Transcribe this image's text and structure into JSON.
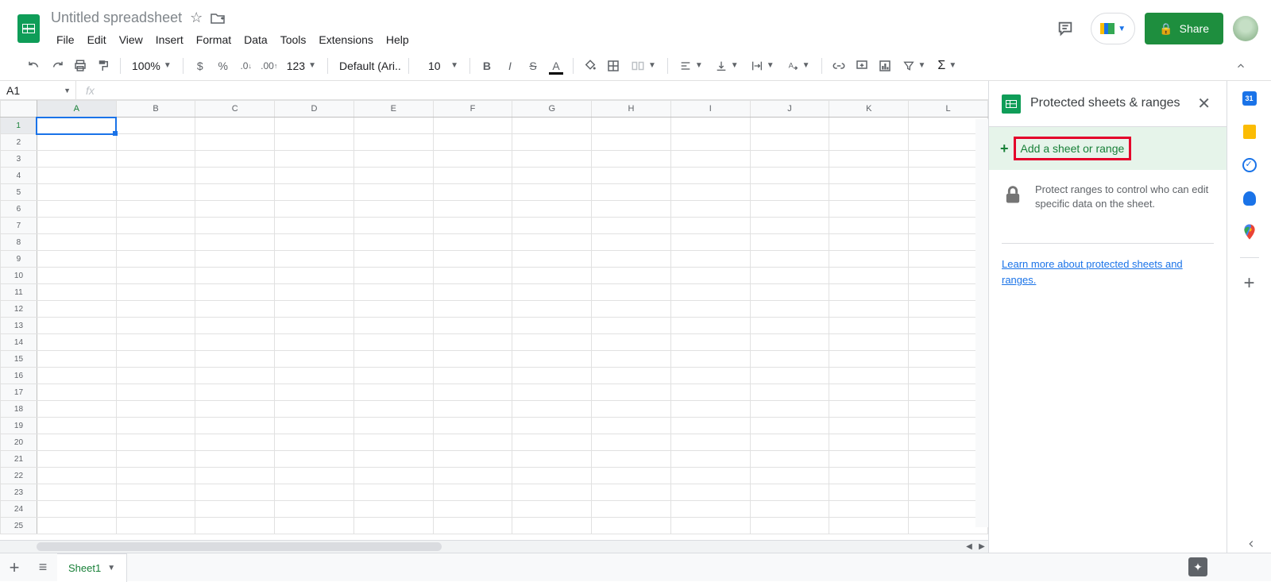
{
  "header": {
    "doc_title": "Untitled spreadsheet",
    "menus": [
      "File",
      "Edit",
      "View",
      "Insert",
      "Format",
      "Data",
      "Tools",
      "Extensions",
      "Help"
    ],
    "share_label": "Share"
  },
  "toolbar": {
    "zoom": "100%",
    "font": "Default (Ari...",
    "font_size": "10",
    "number_format": "123"
  },
  "formula_bar": {
    "name_box": "A1",
    "fx_label": "fx",
    "value": ""
  },
  "grid": {
    "columns": [
      "A",
      "B",
      "C",
      "D",
      "E",
      "F",
      "G",
      "H",
      "I",
      "J",
      "K",
      "L"
    ],
    "rows": 25,
    "selected_cell": "A1",
    "selected_col": "A",
    "selected_row": 1
  },
  "side_panel": {
    "title": "Protected sheets & ranges",
    "add_label": "Add a sheet or range",
    "info_text": "Protect ranges to control who can edit specific data on the sheet.",
    "learn_more": "Learn more about protected sheets and ranges."
  },
  "right_rail": {
    "calendar_day": "31"
  },
  "bottom": {
    "sheet_name": "Sheet1"
  }
}
